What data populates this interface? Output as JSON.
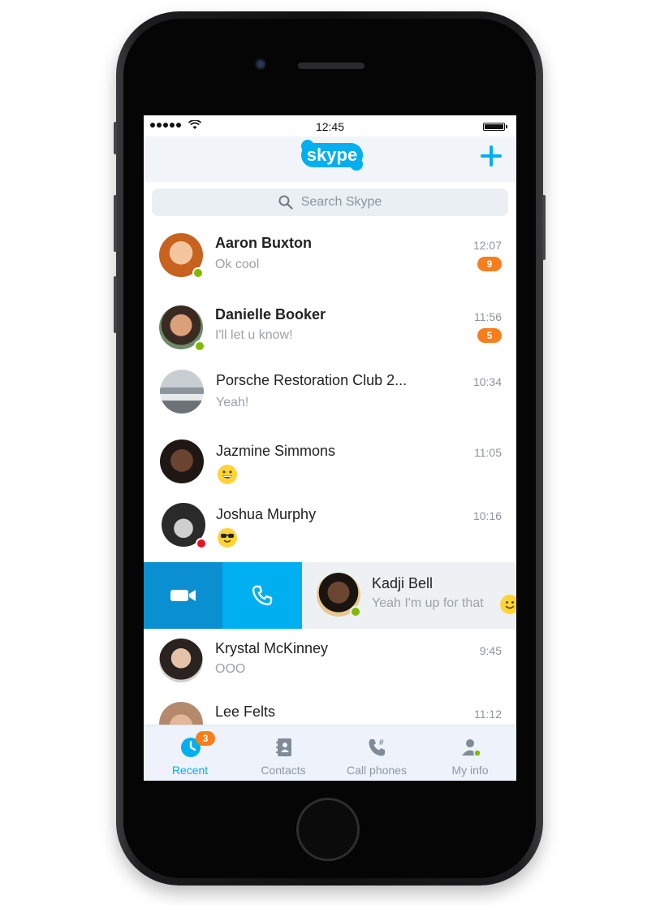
{
  "status_bar": {
    "time": "12:45"
  },
  "header": {
    "logo_text": "skype",
    "add_icon": "plus-icon"
  },
  "search": {
    "placeholder": "Search Skype",
    "icon": "search-icon"
  },
  "chats": [
    {
      "name": "Aaron Buxton",
      "message": "Ok cool",
      "time": "12:07",
      "unread": "9",
      "status": "online",
      "bold": true
    },
    {
      "name": "Danielle Booker",
      "message": "I'll let u know!",
      "time": "11:56",
      "unread": "5",
      "status": "online",
      "bold": true
    },
    {
      "name": "Porsche Restoration Club 2...",
      "message": "Yeah!",
      "time": "10:34"
    },
    {
      "name": "Jazmine Simmons",
      "message_icon": "grinning-emoji",
      "time": "11:05"
    },
    {
      "name": "Joshua Murphy",
      "message_icon": "sunglasses-emoji",
      "time": "10:16",
      "status": "busy"
    },
    {
      "name": "Kadji Bell",
      "message": "Yeah I'm up for that",
      "message_icon": "smile-emoji",
      "status": "online",
      "swiped": true,
      "actions": [
        "video-call-icon",
        "phone-icon"
      ]
    },
    {
      "name": "Krystal McKinney",
      "message": "OOO",
      "time": "9:45"
    },
    {
      "name": "Lee Felts",
      "time": "11:12"
    }
  ],
  "tabs": [
    {
      "label": "Recent",
      "icon": "clock-icon",
      "badge": "3",
      "active": true
    },
    {
      "label": "Contacts",
      "icon": "contacts-book-icon"
    },
    {
      "label": "Call phones",
      "icon": "phone-dialpad-icon"
    },
    {
      "label": "My info",
      "icon": "person-icon"
    }
  ],
  "colors": {
    "accent": "#00aff0",
    "accent_dark": "#0a8fd1",
    "badge": "#f77d1d",
    "online": "#7fba00",
    "busy": "#e81123"
  }
}
